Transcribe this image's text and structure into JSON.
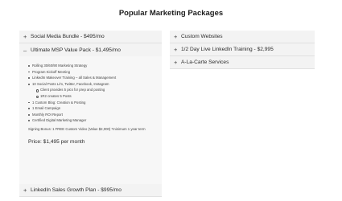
{
  "page": {
    "title": "Popular Marketing Packages"
  },
  "left_column": {
    "items": [
      {
        "sign": "+",
        "label": "Social Media Bundle - $495/mo"
      },
      {
        "sign": "–",
        "label": "Ultimate MSP Value Pack - $1,495/mo"
      }
    ],
    "open_panel": {
      "bullets": [
        "Rolling 30/60/90 Marketing Strategy",
        "Program Kickoff Meeting",
        "LinkedIn Makeover Training – all Sales & Management",
        "10 Social Posts L/m, Twitter, Facebook, Instagram"
      ],
      "sub_bullets": [
        "Client provides 5 pics for prep and posting",
        "1R2 creates 5 Posts"
      ],
      "bullets_after": [
        "1 Custom Blog: Creation & Posting",
        "1 Email Campaign",
        "Monthly ROI Report",
        "Certified Digital Marketing Manager"
      ],
      "bonus": "Signing Bonus: 1 FREE Custom Video (Value $2,000) *minimum 1 year term",
      "price": "Price: $1,495 per month"
    },
    "last_item": {
      "sign": "+",
      "label": "LinkedIn Sales Growth Plan - $995/mo"
    }
  },
  "right_column": {
    "items": [
      {
        "sign": "+",
        "label": "Custom Websites"
      },
      {
        "sign": "+",
        "label": "1/2 Day Live LinkedIn Training - $2,995"
      },
      {
        "sign": "+",
        "label": "A-La-Carte Services"
      }
    ]
  }
}
